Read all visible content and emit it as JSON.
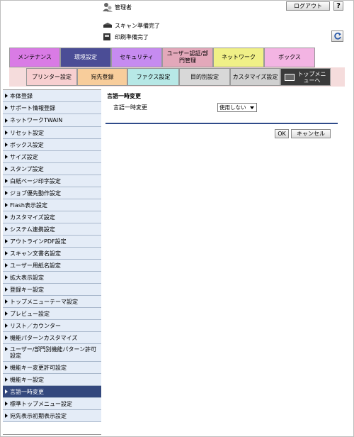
{
  "header": {
    "user_label": "管理者",
    "logout_label": "ログアウト",
    "help_label": "?",
    "status": [
      {
        "icon": "scanner-icon",
        "text": "スキャン準備完了"
      },
      {
        "icon": "printer-icon",
        "text": "印刷準備完了"
      }
    ]
  },
  "tabs": [
    {
      "label": "メンテナンス",
      "color": "#d97be5",
      "active": false
    },
    {
      "label": "環境設定",
      "color": "#4b4d96",
      "active": true
    },
    {
      "label": "セキュリティ",
      "color": "#c68bf0",
      "active": false
    },
    {
      "label": "ユーザー認証/部門管理",
      "color": "#e3a8ba",
      "active": false
    },
    {
      "label": "ネットワーク",
      "color": "#f0f087",
      "active": false
    },
    {
      "label": "ボックス",
      "color": "#f3b4e3",
      "active": false
    }
  ],
  "subtabs": [
    {
      "label": "プリンター設定",
      "color": "#f7cfd0"
    },
    {
      "label": "宛先登録",
      "color": "#f8cd9b"
    },
    {
      "label": "ファクス設定",
      "color": "#b7e8e6"
    },
    {
      "label": "目的別設定",
      "color": "#d8d8d8"
    },
    {
      "label": "カスタマイズ設定",
      "color": "#d0d0d0"
    },
    {
      "label": "トップメニューへ",
      "color": "#3a3a3a"
    }
  ],
  "sidebar": {
    "items": [
      {
        "label": "本体登録"
      },
      {
        "label": "サポート情報登録"
      },
      {
        "label": "ネットワークTWAIN"
      },
      {
        "label": "リセット設定"
      },
      {
        "label": "ボックス設定"
      },
      {
        "label": "サイズ設定"
      },
      {
        "label": "スタンプ設定"
      },
      {
        "label": "白紙ページ印字設定"
      },
      {
        "label": "ジョブ優先動作設定"
      },
      {
        "label": "Flash表示設定"
      },
      {
        "label": "カスタマイズ設定"
      },
      {
        "label": "システム連携設定"
      },
      {
        "label": "アウトラインPDF設定"
      },
      {
        "label": "スキャン文書名設定"
      },
      {
        "label": "ユーザー用紙名設定"
      },
      {
        "label": "拡大表示設定"
      },
      {
        "label": "登録キー設定"
      },
      {
        "label": "トップメニューテーマ設定"
      },
      {
        "label": "プレビュー設定"
      },
      {
        "label": "リスト／カウンター"
      },
      {
        "label": "機能パターンカスタマイズ"
      },
      {
        "label": "ユーザー/部門別機能パターン許可設定"
      },
      {
        "label": "機能キー変更許可設定"
      },
      {
        "label": "機能キー設定"
      },
      {
        "label": "言語一時変更",
        "active": true
      },
      {
        "label": "標準トップメニュー設定"
      },
      {
        "label": "宛先表示初期表示設定"
      }
    ]
  },
  "main": {
    "title": "言語一時変更",
    "field_label": "言語一時変更",
    "select_value": "使用しない",
    "ok_label": "OK",
    "cancel_label": "キャンセル"
  },
  "colors": {
    "sidebar_bg": "#e4ecf7",
    "sidebar_active": "#33487d",
    "divider": "#2f4b8a"
  }
}
